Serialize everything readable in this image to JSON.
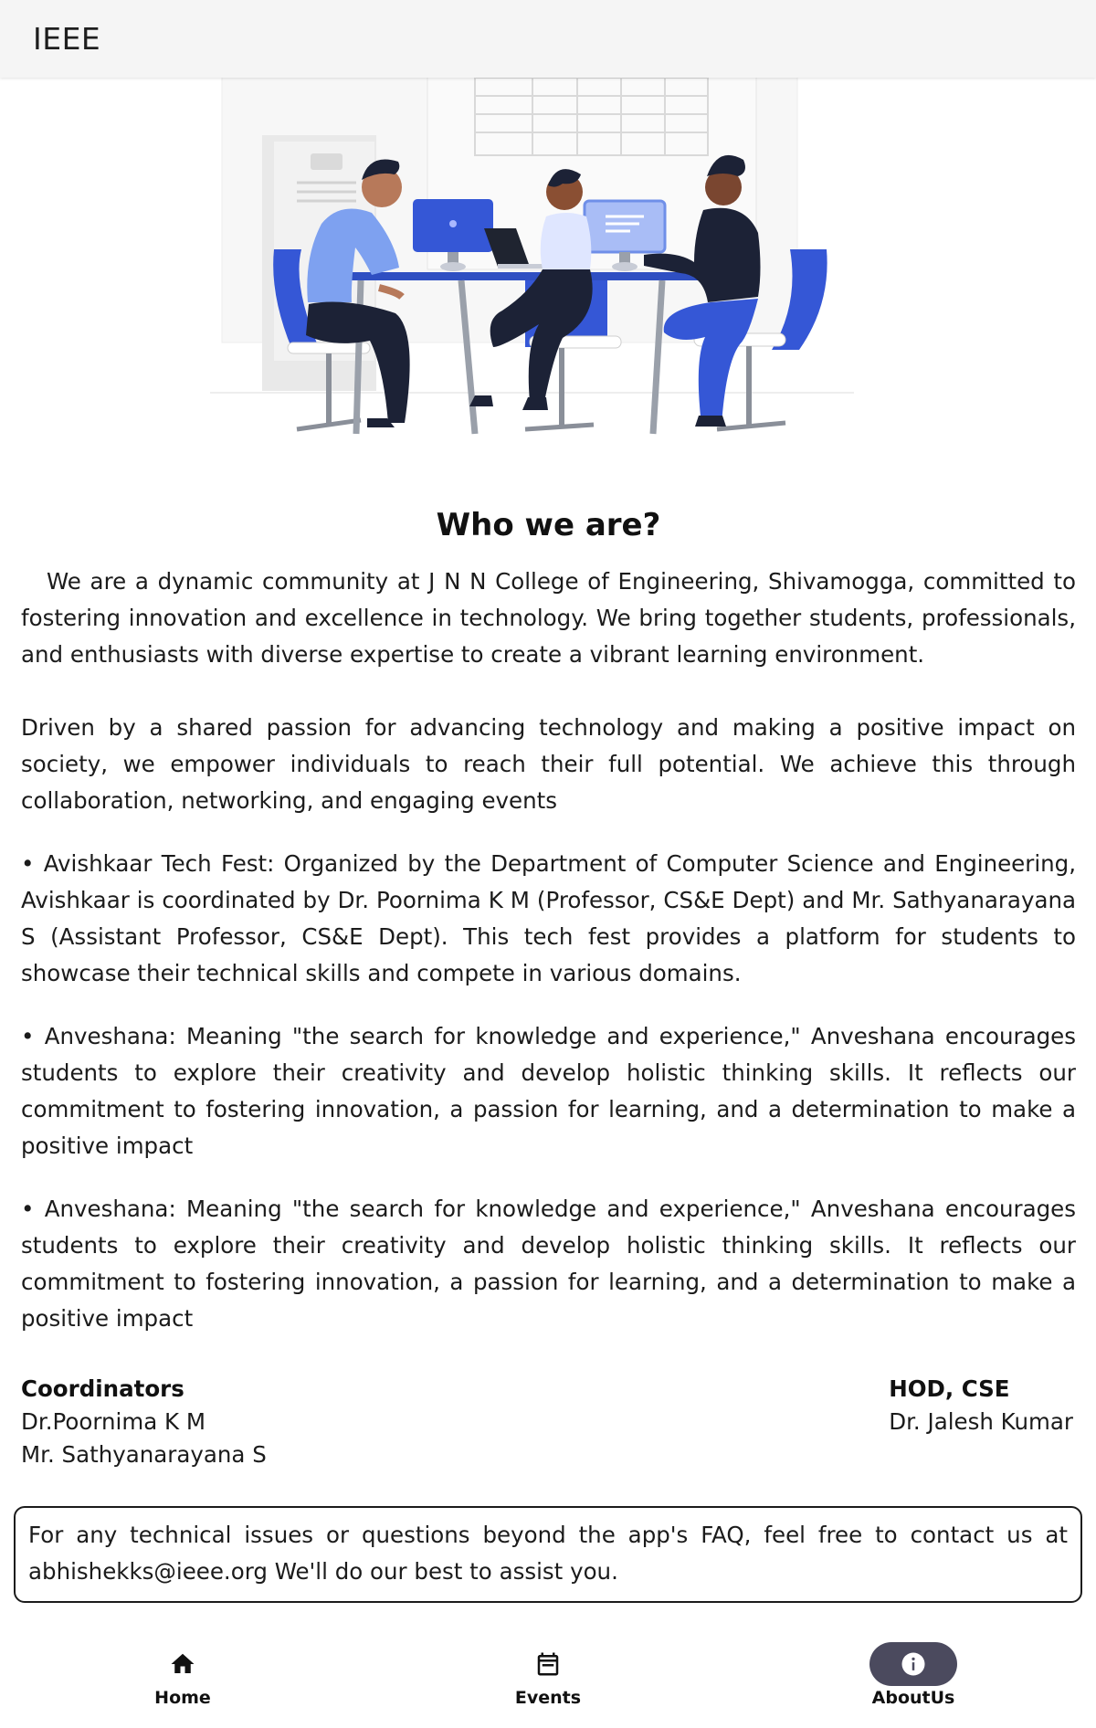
{
  "appbar": {
    "title": "IEEE"
  },
  "hero": {
    "illustration": "team-working-at-desks-illustration"
  },
  "about": {
    "heading": "Who we are?",
    "intro": "We are a dynamic community at J N N College of Engineering, Shivamogga, committed to fostering innovation and excellence in technology. We bring together students, professionals, and enthusiasts with diverse expertise to create a vibrant learning environment.",
    "mission": "Driven by a shared passion for advancing technology and making a positive impact on society, we empower individuals to reach their full potential. We achieve this through collaboration, networking, and engaging events",
    "events": [
      "• Avishkaar Tech Fest: Organized by the Department of Computer Science and Engineering, Avishkaar is coordinated by Dr. Poornima K M (Professor, CS&E Dept) and Mr. Sathyanarayana S (Assistant Professor, CS&E Dept). This tech fest provides a platform for students to showcase their technical skills and compete in various domains.",
      "• Anveshana: Meaning \"the search for knowledge and experience,\" Anveshana encourages students to explore their creativity and develop holistic thinking skills. It reflects our commitment to fostering innovation, a passion for learning, and a determination to make a positive impact",
      "• Anveshana: Meaning \"the search for knowledge and experience,\" Anveshana encourages students to explore their creativity and develop holistic thinking skills. It reflects our commitment to fostering innovation, a passion for learning, and a determination to make a positive impact"
    ]
  },
  "coordinators": {
    "label": "Coordinators",
    "names": [
      "Dr.Poornima K M",
      "Mr. Sathyanarayana S"
    ]
  },
  "hod": {
    "label": "HOD, CSE",
    "name": "Dr. Jalesh Kumar"
  },
  "contact": {
    "text": "For any technical issues or questions beyond the app's FAQ, feel free to contact us at abhishekks@ieee.org We'll do our best to assist you."
  },
  "nav": {
    "items": [
      {
        "label": "Home",
        "icon": "home-icon",
        "active": false
      },
      {
        "label": "Events",
        "icon": "calendar-icon",
        "active": false
      },
      {
        "label": "AboutUs",
        "icon": "info-icon",
        "active": true
      }
    ]
  },
  "colors": {
    "accent_blue": "#3557d6",
    "active_pill": "#4b4a5e",
    "appbar_bg": "#f5f5f5"
  }
}
